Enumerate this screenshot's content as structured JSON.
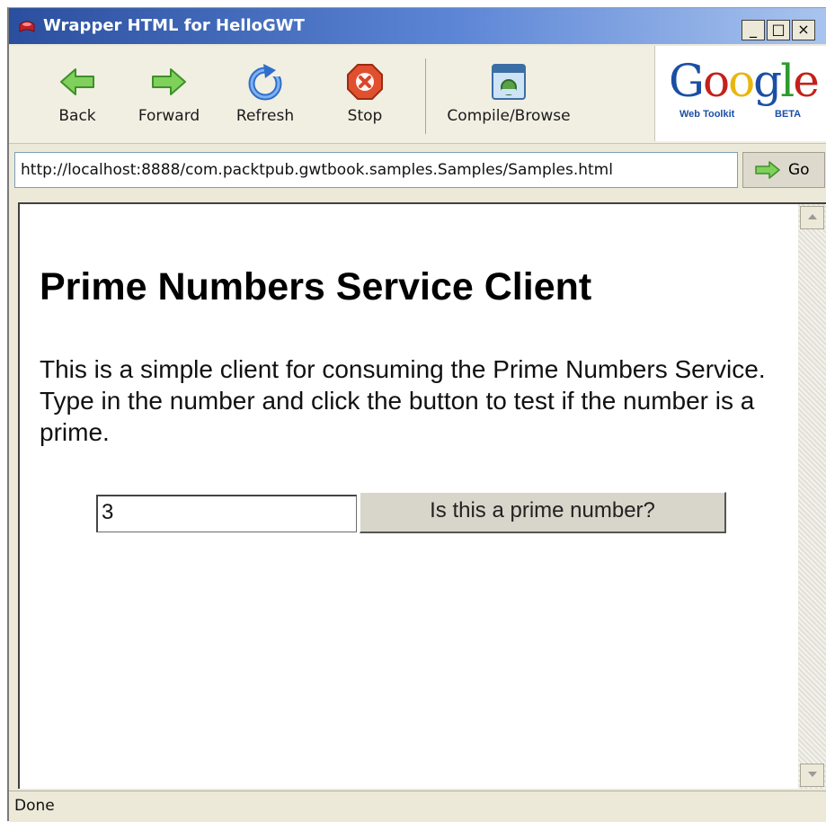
{
  "window": {
    "title": "Wrapper HTML for HelloGWT",
    "controls": {
      "minimize": "_",
      "maximize": "□",
      "close": "×"
    }
  },
  "toolbar": {
    "back": {
      "label": "Back",
      "icon": "back-arrow-icon"
    },
    "forward": {
      "label": "Forward",
      "icon": "forward-arrow-icon"
    },
    "refresh": {
      "label": "Refresh",
      "icon": "refresh-icon"
    },
    "stop": {
      "label": "Stop",
      "icon": "stop-icon"
    },
    "compile": {
      "label": "Compile/Browse",
      "icon": "compile-browse-icon"
    }
  },
  "logo": {
    "brand": "Google",
    "subtitle": "Web Toolkit",
    "badge": "BETA"
  },
  "address_bar": {
    "url": "http://localhost:8888/com.packtpub.gwtbook.samples.Samples/Samples.html",
    "go_label": "Go"
  },
  "page": {
    "title": "Prime Numbers Service Client",
    "description": "This is a simple client for consuming the Prime Numbers Service. Type in the number and click the button to test if the number is a prime.",
    "input_value": "3",
    "button_label": "Is this a prime number?"
  },
  "status": {
    "text": "Done"
  },
  "colors": {
    "titlebar": "#2a4f9e",
    "chrome": "#ece9d8",
    "accent_green": "#58b93a",
    "stop_red": "#d9452b"
  }
}
